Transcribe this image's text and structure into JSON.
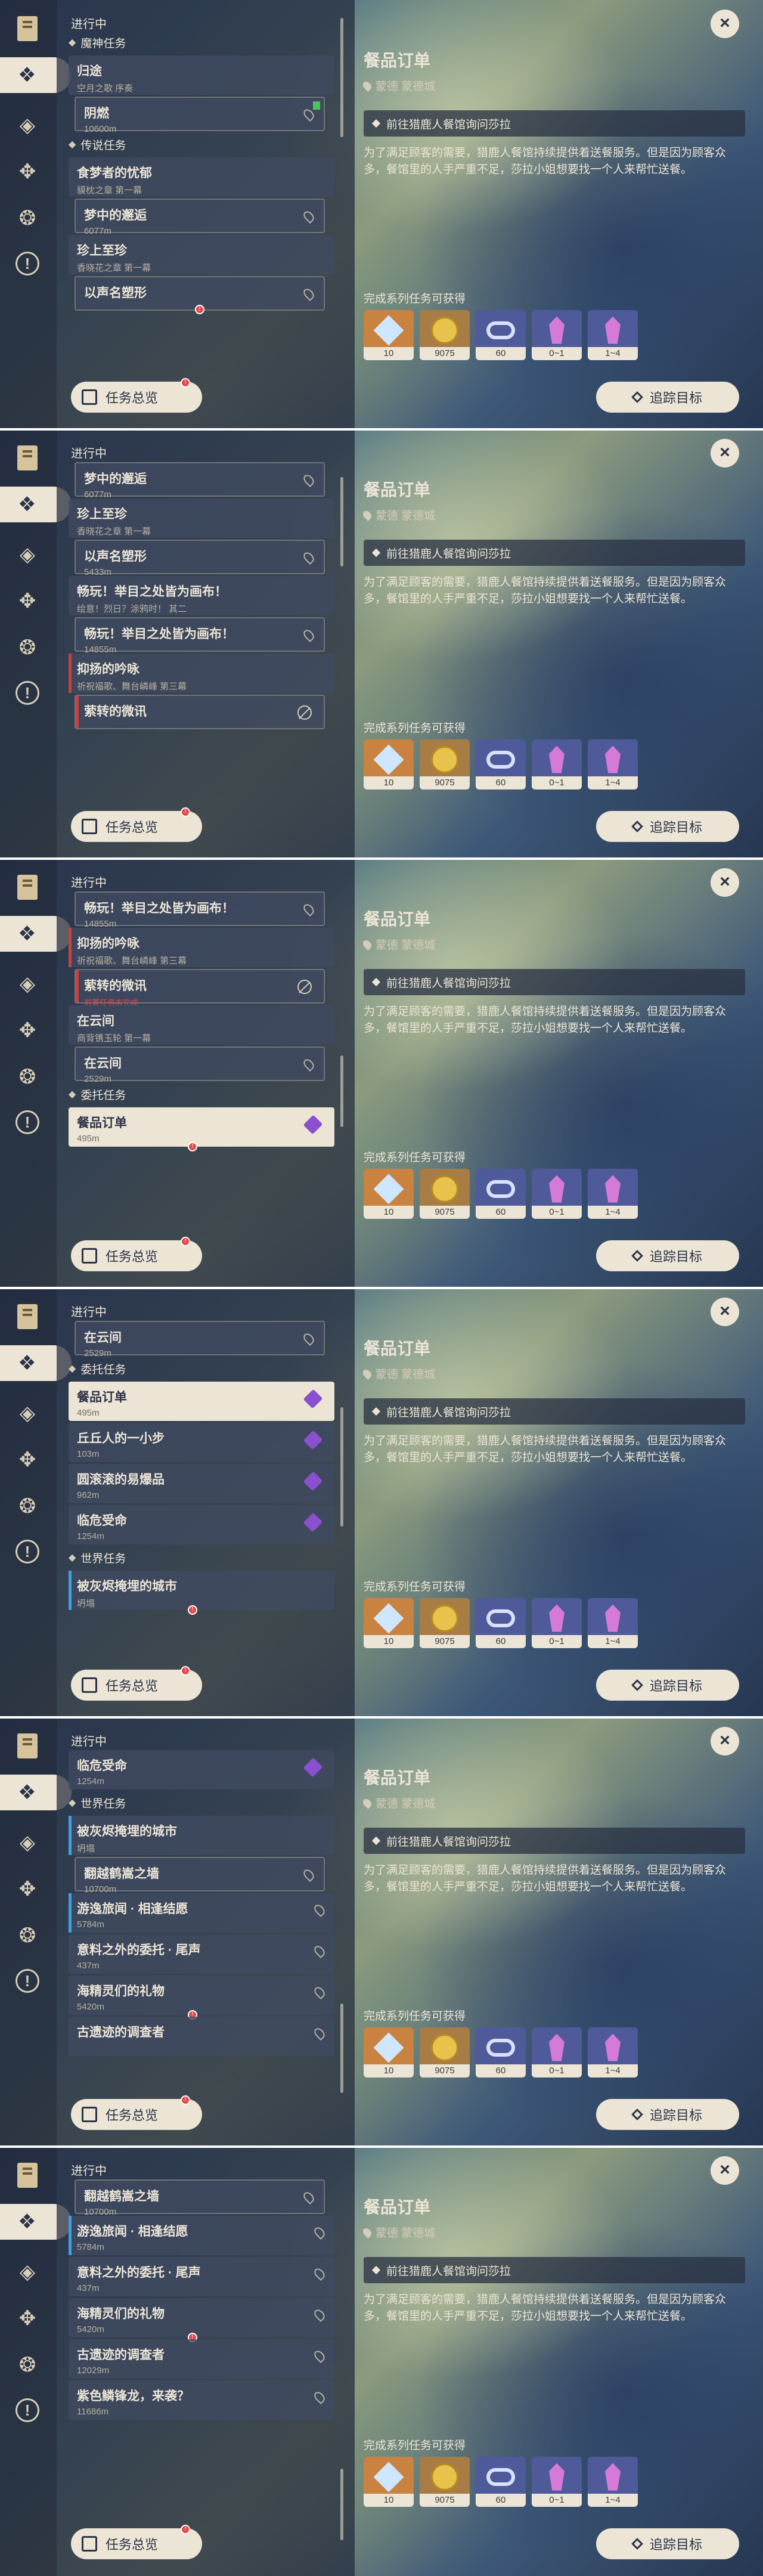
{
  "common": {
    "in_progress": "进行中",
    "quest_overview": "任务总览",
    "track_target": "追踪目标",
    "close": "×",
    "badge": "!"
  },
  "detail": {
    "title": "餐品订单",
    "location": "蒙德 蒙德城",
    "objective": "前往猎鹿人餐馆询问莎拉",
    "description": "为了满足顾客的需要，猎鹿人餐馆持续提供着送餐服务。但是因为顾客众多，餐馆里的人手严重不足，莎拉小姐想要找一个人来帮忙送餐。",
    "rewards_label": "完成系列任务可获得",
    "rewards": [
      {
        "icon": "adventure-exp-icon",
        "count": "10",
        "color": "#c9823f"
      },
      {
        "icon": "mora-icon",
        "count": "9075",
        "color": "#a87d45"
      },
      {
        "icon": "companionship-exp-icon",
        "count": "60",
        "color": "#4f5a9a"
      },
      {
        "icon": "crystal-chunk-icon",
        "count": "0~1",
        "color": "#4f5a9a"
      },
      {
        "icon": "crystal-fragment-icon",
        "count": "1~4",
        "color": "#4f5a9a"
      }
    ]
  },
  "frames": [
    {
      "scroll_top": 0,
      "items": [
        {
          "kind": "cat",
          "label": "魔神任务",
          "icon": "archon-quest-icon"
        },
        {
          "kind": "card",
          "title": "归途",
          "sub": "空月之歌 序奏",
          "bar": "none",
          "icon": "none"
        },
        {
          "kind": "sub",
          "title": "阴燃",
          "sub": "10600m",
          "icon": "pin",
          "flag": true
        },
        {
          "kind": "cat",
          "label": "传说任务",
          "icon": "legend-quest-icon"
        },
        {
          "kind": "card",
          "title": "食梦者的忧郁",
          "sub": "貘枕之章 第一幕",
          "icon": "none"
        },
        {
          "kind": "sub",
          "title": "梦中的邂逅",
          "sub": "6077m",
          "icon": "pin"
        },
        {
          "kind": "card",
          "title": "珍上至珍",
          "sub": "香晓花之章 第一幕",
          "icon": "none"
        },
        {
          "kind": "sub",
          "title": "以声名塑形",
          "sub": "",
          "icon": "pin",
          "dot": true
        }
      ]
    },
    {
      "scroll_top": 0,
      "items": [
        {
          "kind": "sub",
          "title": "梦中的邂逅",
          "sub": "6077m",
          "icon": "pin"
        },
        {
          "kind": "card",
          "title": "珍上至珍",
          "sub": "香晓花之章 第一幕",
          "icon": "none"
        },
        {
          "kind": "sub",
          "title": "以声名塑形",
          "sub": "5433m",
          "icon": "pin"
        },
        {
          "kind": "card",
          "title": "畅玩！举目之处皆为画布！",
          "sub": "绘意！烈日？涂鸦时！ 其二",
          "icon": "none"
        },
        {
          "kind": "sub",
          "title": "畅玩！举目之处皆为画布！",
          "sub": "14855m",
          "icon": "pin"
        },
        {
          "kind": "card",
          "title": "抑扬的吟咏",
          "sub": "祈祝福歌、舞台嶙峰 第三幕",
          "bar": "red",
          "icon": "none"
        },
        {
          "kind": "sub",
          "title": "萦转的微讯",
          "sub": "",
          "icon": "blocked",
          "bar": "red"
        }
      ]
    },
    {
      "scroll_top": 0,
      "items": [
        {
          "kind": "sub",
          "title": "畅玩！举目之处皆为画布！",
          "sub": "14855m",
          "icon": "pin"
        },
        {
          "kind": "card",
          "title": "抑扬的吟咏",
          "sub": "祈祝福歌、舞台嶙峰 第三幕",
          "bar": "red",
          "icon": "none"
        },
        {
          "kind": "sub",
          "title": "萦转的微讯",
          "sub": "",
          "icon": "blocked",
          "bar": "red",
          "warn": "前置任务未完成"
        },
        {
          "kind": "card",
          "title": "在云间",
          "sub": "商背镌玉轮 第一幕",
          "icon": "none"
        },
        {
          "kind": "sub",
          "title": "在云间",
          "sub": "2529m",
          "icon": "pin"
        },
        {
          "kind": "cat",
          "label": "委托任务",
          "icon": "commission-icon"
        },
        {
          "kind": "act",
          "title": "餐品订单",
          "sub": "495m",
          "icon": "gem",
          "dot": true
        }
      ]
    },
    {
      "scroll_top": 0,
      "items": [
        {
          "kind": "sub",
          "title": "在云间",
          "sub": "2529m",
          "icon": "pin"
        },
        {
          "kind": "cat",
          "label": "委托任务",
          "icon": "commission-icon"
        },
        {
          "kind": "act",
          "title": "餐品订单",
          "sub": "495m",
          "icon": "gem"
        },
        {
          "kind": "card",
          "title": "丘丘人的一小步",
          "sub": "103m",
          "icon": "gem"
        },
        {
          "kind": "card",
          "title": "圆滚滚的易爆品",
          "sub": "962m",
          "icon": "gem"
        },
        {
          "kind": "card",
          "title": "临危受命",
          "sub": "1254m",
          "icon": "gem"
        },
        {
          "kind": "cat",
          "label": "世界任务",
          "icon": "world-quest-icon"
        },
        {
          "kind": "card",
          "title": "被灰烬掩埋的城市",
          "sub": "坍塌",
          "bar": "blue",
          "icon": "none",
          "dot": true
        }
      ]
    },
    {
      "scroll_top": 0,
      "items": [
        {
          "kind": "card",
          "title": "临危受命",
          "sub": "1254m",
          "icon": "gem"
        },
        {
          "kind": "cat",
          "label": "世界任务",
          "icon": "world-quest-icon"
        },
        {
          "kind": "card",
          "title": "被灰烬掩埋的城市",
          "sub": "坍塌",
          "bar": "blue",
          "icon": "none"
        },
        {
          "kind": "sub",
          "title": "翻越鹤嵩之墙",
          "sub": "10700m",
          "icon": "pin"
        },
        {
          "kind": "card",
          "title": "游逸旅闻 · 相逢结愿",
          "sub": "5784m",
          "bar": "blue",
          "icon": "pin"
        },
        {
          "kind": "card",
          "title": "意料之外的委托 · 尾声",
          "sub": "437m",
          "icon": "pin"
        },
        {
          "kind": "card",
          "title": "海精灵们的礼物",
          "sub": "5420m",
          "icon": "pin",
          "dot": true
        },
        {
          "kind": "card",
          "title": "古遗迹的调查者",
          "sub": "",
          "icon": "pin"
        }
      ]
    },
    {
      "scroll_top": 0,
      "items": [
        {
          "kind": "sub",
          "title": "翻越鹤嵩之墙",
          "sub": "10700m",
          "icon": "pin"
        },
        {
          "kind": "card",
          "title": "游逸旅闻 · 相逢结愿",
          "sub": "5784m",
          "bar": "blue",
          "icon": "pin"
        },
        {
          "kind": "card",
          "title": "意料之外的委托 · 尾声",
          "sub": "437m",
          "icon": "pin"
        },
        {
          "kind": "card",
          "title": "海精灵们的礼物",
          "sub": "5420m",
          "icon": "pin",
          "dot": true
        },
        {
          "kind": "card",
          "title": "古遗迹的调查者",
          "sub": "12029m",
          "icon": "pin"
        },
        {
          "kind": "card",
          "title": "紫色鳞锋龙，来袭？",
          "sub": "11686m",
          "icon": "pin"
        }
      ]
    }
  ]
}
